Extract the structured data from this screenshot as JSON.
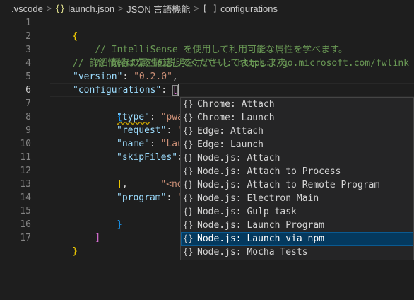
{
  "breadcrumb": {
    "folder": ".vscode",
    "file_icon": "{}",
    "file": "launch.json",
    "language": "JSON 言語機能",
    "symbol_icon": "[ ]",
    "symbol": "configurations"
  },
  "editor": {
    "line_numbers": [
      "1",
      "2",
      "3",
      "4",
      "5",
      "6",
      "7",
      "8",
      "9",
      "10",
      "11",
      "12",
      "13",
      "14",
      "15",
      "16",
      "17"
    ],
    "active_line": "6",
    "code": {
      "l1_brace": "{",
      "l2_comment": "// IntelliSense を使用して利用可能な属性を学べます。",
      "l3_comment": "// 既存の属性の説明をホバーして表示します。",
      "l4_comment": "// 詳細情報は次を確認してください: ",
      "l4_link": "https://go.microsoft.com/fwlink",
      "l5_key": "\"version\"",
      "l5_colon": ": ",
      "l5_value": "\"0.2.0\"",
      "l5_comma": ",",
      "l6_key": "\"configurations\"",
      "l6_colon": ": ",
      "l6_bracket": "[",
      "l7_brace": "{",
      "l8_key": "\"type\"",
      "l8_colon": ": ",
      "l8_value": "\"pwa",
      "l9_key": "\"request\"",
      "l9_colon": ": ",
      "l9_value": "\"",
      "l10_key": "\"name\"",
      "l10_colon": ": ",
      "l10_value": "\"Lau",
      "l11_key": "\"skipFiles\"",
      "l11_colon": ":",
      "l12_value": "\"<node_i",
      "l13_bracket": "]",
      "l13_comma": ",",
      "l14_key": "\"program\"",
      "l14_colon": ": ",
      "l14_value": "\"",
      "l15_brace": "}",
      "l16_bracket": "]",
      "l17_brace": "}"
    }
  },
  "suggest": {
    "icon_glyph": "{}",
    "items": [
      {
        "label": "Chrome: Attach",
        "highlight": ""
      },
      {
        "label": "Chrome: Launch",
        "highlight": ""
      },
      {
        "label": "Edge: Attach",
        "highlight": ""
      },
      {
        "label": "Edge: Launch",
        "highlight": ""
      },
      {
        "label": "Node.js: Attach",
        "highlight": ""
      },
      {
        "label": "Node.js: Attach to Process",
        "highlight": ""
      },
      {
        "label": "Node.js: Attach to Remote Program",
        "highlight": ""
      },
      {
        "label": "Node.js: Electron Main",
        "highlight": ""
      },
      {
        "label": "Node.js: Gulp task",
        "highlight": ""
      },
      {
        "label": "Node.js: Launch Program",
        "highlight": ""
      },
      {
        "label": "Node.js: Launch via npm",
        "highlight": ""
      },
      {
        "label": "Node.js: Mocha Tests",
        "highlight": ""
      }
    ],
    "selected_index": 10
  },
  "colors": {
    "background": "#1e1e1e",
    "suggest_selected": "#04395e",
    "comment": "#6a9955",
    "key": "#9cdcfe",
    "string": "#ce9178"
  }
}
